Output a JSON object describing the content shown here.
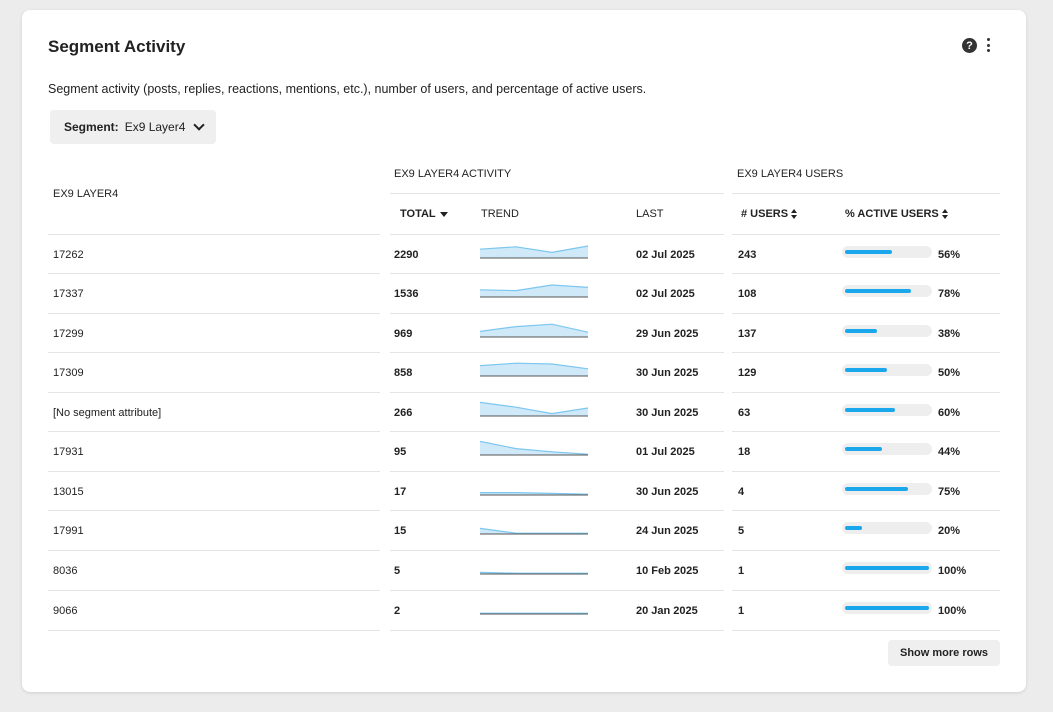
{
  "header": {
    "title": "Segment Activity",
    "help_icon": "question-circle-icon",
    "more_icon": "vertical-dots-icon"
  },
  "description": "Segment activity (posts, replies, reactions, mentions, etc.), number of users, and percentage of active users.",
  "segment_filter": {
    "label": "Segment:",
    "value": "Ex9 Layer4"
  },
  "table": {
    "group_headers": {
      "segment": "EX9 LAYER4",
      "activity": "EX9 LAYER4 ACTIVITY",
      "users": "EX9 LAYER4 USERS"
    },
    "columns": {
      "total": "TOTAL",
      "trend": "TREND",
      "last": "LAST",
      "users": "# USERS",
      "active": "% ACTIVE USERS"
    },
    "rows": [
      {
        "name": "17262",
        "total": "2290",
        "last": "02 Jul 2025",
        "users": "243",
        "active_pct": 56,
        "active_label": "56%",
        "trend": [
          0.55,
          0.7,
          0.35,
          0.75
        ]
      },
      {
        "name": "17337",
        "total": "1536",
        "last": "02 Jul 2025",
        "users": "108",
        "active_pct": 78,
        "active_label": "78%",
        "trend": [
          0.45,
          0.4,
          0.75,
          0.6
        ]
      },
      {
        "name": "17299",
        "total": "969",
        "last": "29 Jun 2025",
        "users": "137",
        "active_pct": 38,
        "active_label": "38%",
        "trend": [
          0.35,
          0.65,
          0.8,
          0.3
        ]
      },
      {
        "name": "17309",
        "total": "858",
        "last": "30 Jun 2025",
        "users": "129",
        "active_pct": 50,
        "active_label": "50%",
        "trend": [
          0.65,
          0.8,
          0.75,
          0.45
        ]
      },
      {
        "name": "[No segment attribute]",
        "total": "266",
        "last": "30 Jun 2025",
        "users": "63",
        "active_pct": 60,
        "active_label": "60%",
        "trend": [
          0.85,
          0.55,
          0.15,
          0.5
        ]
      },
      {
        "name": "17931",
        "total": "95",
        "last": "01 Jul 2025",
        "users": "18",
        "active_pct": 44,
        "active_label": "44%",
        "trend": [
          0.85,
          0.4,
          0.2,
          0.05
        ]
      },
      {
        "name": "13015",
        "total": "17",
        "last": "30 Jun 2025",
        "users": "4",
        "active_pct": 75,
        "active_label": "75%",
        "trend": [
          0.15,
          0.15,
          0.1,
          0.05
        ]
      },
      {
        "name": "17991",
        "total": "15",
        "last": "24 Jun 2025",
        "users": "5",
        "active_pct": 20,
        "active_label": "20%",
        "trend": [
          0.35,
          0.05,
          0.05,
          0.05
        ]
      },
      {
        "name": "8036",
        "total": "5",
        "last": "10 Feb 2025",
        "users": "1",
        "active_pct": 100,
        "active_label": "100%",
        "trend": [
          0.1,
          0.05,
          0.05,
          0.05
        ]
      },
      {
        "name": "9066",
        "total": "2",
        "last": "20 Jan 2025",
        "users": "1",
        "active_pct": 100,
        "active_label": "100%",
        "trend": [
          0.05,
          0.05,
          0.05,
          0.05
        ]
      }
    ]
  },
  "show_more_label": "Show more rows",
  "colors": {
    "accent": "#1aa7ec",
    "trend_fill": "#cfe9f8",
    "trend_line": "#7cc6ef"
  }
}
